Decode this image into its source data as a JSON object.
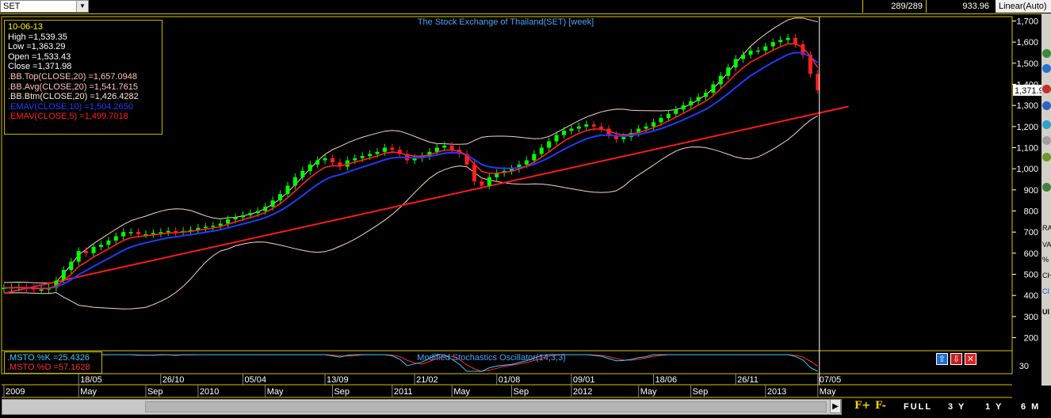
{
  "toolbar": {
    "symbol": "SET",
    "cells": [
      "289/289",
      "933.96"
    ],
    "scale": "Linear(Auto)"
  },
  "legend": {
    "date": "10-06-13",
    "high": "High  =1,539.35",
    "low": "Low  =1,363.29",
    "open": "Open  =1,533.43",
    "close": "Close  =1,371.98",
    "bb_top": ".BB.Top(CLOSE,20)   =1,657.0948",
    "bb_avg": ".BB.Avg(CLOSE,20)   =1,541.7615",
    "bb_btm": ".BB.Btm(CLOSE,20)  =1,426.4282",
    "emav10": ".EMAV(CLOSE,10)   =1,504.2650",
    "emav5": ".EMAV(CLOSE,5)   =1,499.7018"
  },
  "stoch_legend": {
    "k": ".MSTO.%K   =25.4326",
    "d": ".MSTO.%D   =57.1628"
  },
  "right_panel": [
    "RA",
    "VA",
    "%",
    "CH",
    "CI",
    "UI"
  ],
  "colors": {
    "background": "#000000",
    "grid_border": "#d9c200",
    "up_candle": "#00ff00",
    "down_candle": "#ff2020",
    "bollinger": "#ffd0d0",
    "emav10": "#1e3cff",
    "emav5": "#ff2020",
    "trendline": "#ff1a1a",
    "stoch_k": "#40c8ff",
    "stoch_d": "#ff3030",
    "title": "#4aa3ff"
  },
  "osc_buttons": [
    "up-arrow-icon",
    "down-arrow-icon",
    "close-icon"
  ],
  "bottom": {
    "buttons": [
      "FULL",
      "3 Y",
      "1 Y",
      "6 M"
    ],
    "zoom_in": "F+",
    "zoom_out": "F-"
  },
  "chart_data": {
    "type": "candlestick",
    "title": "The Stock Exchange of Thailand(SET) [week]",
    "price_axis": {
      "min": 200,
      "max": 1700,
      "ticks": [
        200,
        300,
        400,
        500,
        600,
        700,
        800,
        900,
        1000,
        1100,
        1200,
        1300,
        1400,
        1500,
        1600,
        1700
      ],
      "tick_labels": [
        "200",
        "300",
        "400",
        "500",
        "600",
        "700",
        "800",
        "900",
        "1,000",
        "1,100",
        "1,200",
        "1,300",
        "1,400",
        "1,500",
        "1,600",
        "1,700"
      ],
      "last_price_label": "1,371.98"
    },
    "x_axis": {
      "labels": [
        {
          "i": 0,
          "top": "",
          "bottom": "2009"
        },
        {
          "i": 10,
          "top": "18/05",
          "bottom": "May"
        },
        {
          "i": 19,
          "top": "",
          "bottom": "Sep"
        },
        {
          "i": 21,
          "top": "26/10",
          "bottom": ""
        },
        {
          "i": 26,
          "top": "",
          "bottom": "2010"
        },
        {
          "i": 32,
          "top": "05/04",
          "bottom": ""
        },
        {
          "i": 35,
          "top": "",
          "bottom": "May"
        },
        {
          "i": 43,
          "top": "13/09",
          "bottom": ""
        },
        {
          "i": 44,
          "top": "",
          "bottom": "Sep"
        },
        {
          "i": 52,
          "top": "",
          "bottom": "2011"
        },
        {
          "i": 55,
          "top": "21/02",
          "bottom": ""
        },
        {
          "i": 60,
          "top": "",
          "bottom": "May"
        },
        {
          "i": 66,
          "top": "01/08",
          "bottom": ""
        },
        {
          "i": 68,
          "top": "",
          "bottom": "Sep"
        },
        {
          "i": 76,
          "top": "09/01",
          "bottom": "2012"
        },
        {
          "i": 85,
          "top": "",
          "bottom": "May"
        },
        {
          "i": 87,
          "top": "18/06",
          "bottom": ""
        },
        {
          "i": 92,
          "top": "",
          "bottom": "Sep"
        },
        {
          "i": 98,
          "top": "26/11",
          "bottom": ""
        },
        {
          "i": 102,
          "top": "",
          "bottom": "2013"
        },
        {
          "i": 109,
          "top": "07/05",
          "bottom": "May"
        }
      ]
    },
    "close": [
      436,
      438,
      440,
      434,
      428,
      428,
      436,
      470,
      520,
      560,
      610,
      600,
      630,
      640,
      660,
      680,
      700,
      700,
      690,
      690,
      695,
      700,
      705,
      700,
      705,
      710,
      720,
      725,
      730,
      740,
      760,
      770,
      780,
      790,
      800,
      820,
      850,
      880,
      920,
      960,
      990,
      1020,
      1040,
      1050,
      1030,
      1010,
      1040,
      1050,
      1060,
      1070,
      1080,
      1100,
      1090,
      1070,
      1040,
      1050,
      1060,
      1080,
      1100,
      1110,
      1090,
      1070,
      1020,
      940,
      920,
      960,
      980,
      990,
      1000,
      1020,
      1040,
      1070,
      1100,
      1130,
      1160,
      1180,
      1190,
      1200,
      1210,
      1200,
      1190,
      1160,
      1140,
      1150,
      1170,
      1190,
      1200,
      1220,
      1240,
      1260,
      1280,
      1300,
      1320,
      1340,
      1360,
      1400,
      1440,
      1480,
      1520,
      1540,
      1560,
      1560,
      1580,
      1600,
      1610,
      1620,
      1590,
      1540,
      1450,
      1372
    ],
    "indicator_last": {
      "bb_top": 1657.0948,
      "bb_avg": 1541.7615,
      "bb_btm": 1426.4282,
      "emav10": 1504.265,
      "emav5": 1499.7018,
      "stoch_k": 25.4326,
      "stoch_d": 57.1628
    },
    "trendline": {
      "from": [
        0,
        410
      ],
      "to": [
        111,
        1295
      ]
    },
    "oscillator": {
      "title": "Modified Stochastics Oscillator(14,3,3)",
      "tick_label": "30"
    }
  }
}
